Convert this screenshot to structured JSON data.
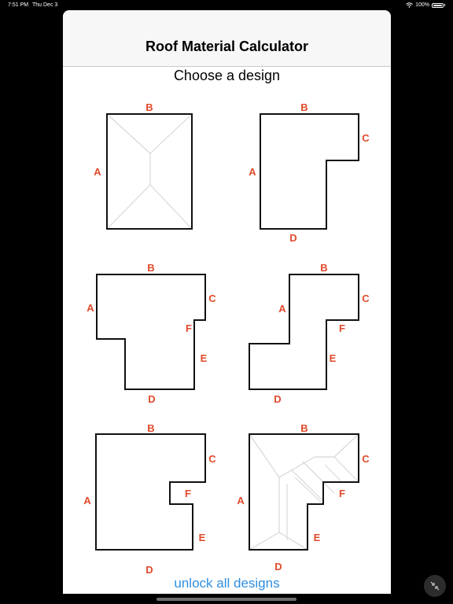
{
  "status_bar": {
    "time": "7:51 PM",
    "date": "Thu Dec 3",
    "battery": "100%",
    "icons": [
      "wifi-icon",
      "battery-icon"
    ]
  },
  "header": {
    "title": "Roof Material Calculator"
  },
  "main": {
    "subtitle": "Choose a design",
    "unlock_label": "unlock all designs",
    "designs": [
      {
        "labels": {
          "a": "A",
          "b": "B"
        }
      },
      {
        "labels": {
          "a": "A",
          "b": "B",
          "c": "C",
          "d": "D"
        }
      },
      {
        "labels": {
          "a": "A",
          "b": "B",
          "c": "C",
          "d": "D",
          "e": "E",
          "f": "F"
        }
      },
      {
        "labels": {
          "a": "A",
          "b": "B",
          "c": "C",
          "d": "D",
          "e": "E",
          "f": "F"
        }
      },
      {
        "labels": {
          "a": "A",
          "b": "B",
          "c": "C",
          "d": "D",
          "e": "E",
          "f": "F"
        }
      },
      {
        "labels": {
          "a": "A",
          "b": "B",
          "c": "C",
          "d": "D",
          "e": "E",
          "f": "F"
        }
      }
    ]
  },
  "colors": {
    "label": "#e04a2a",
    "link": "#2f8fe0",
    "outline": "#111111",
    "ridge": "#d8d8d8"
  }
}
